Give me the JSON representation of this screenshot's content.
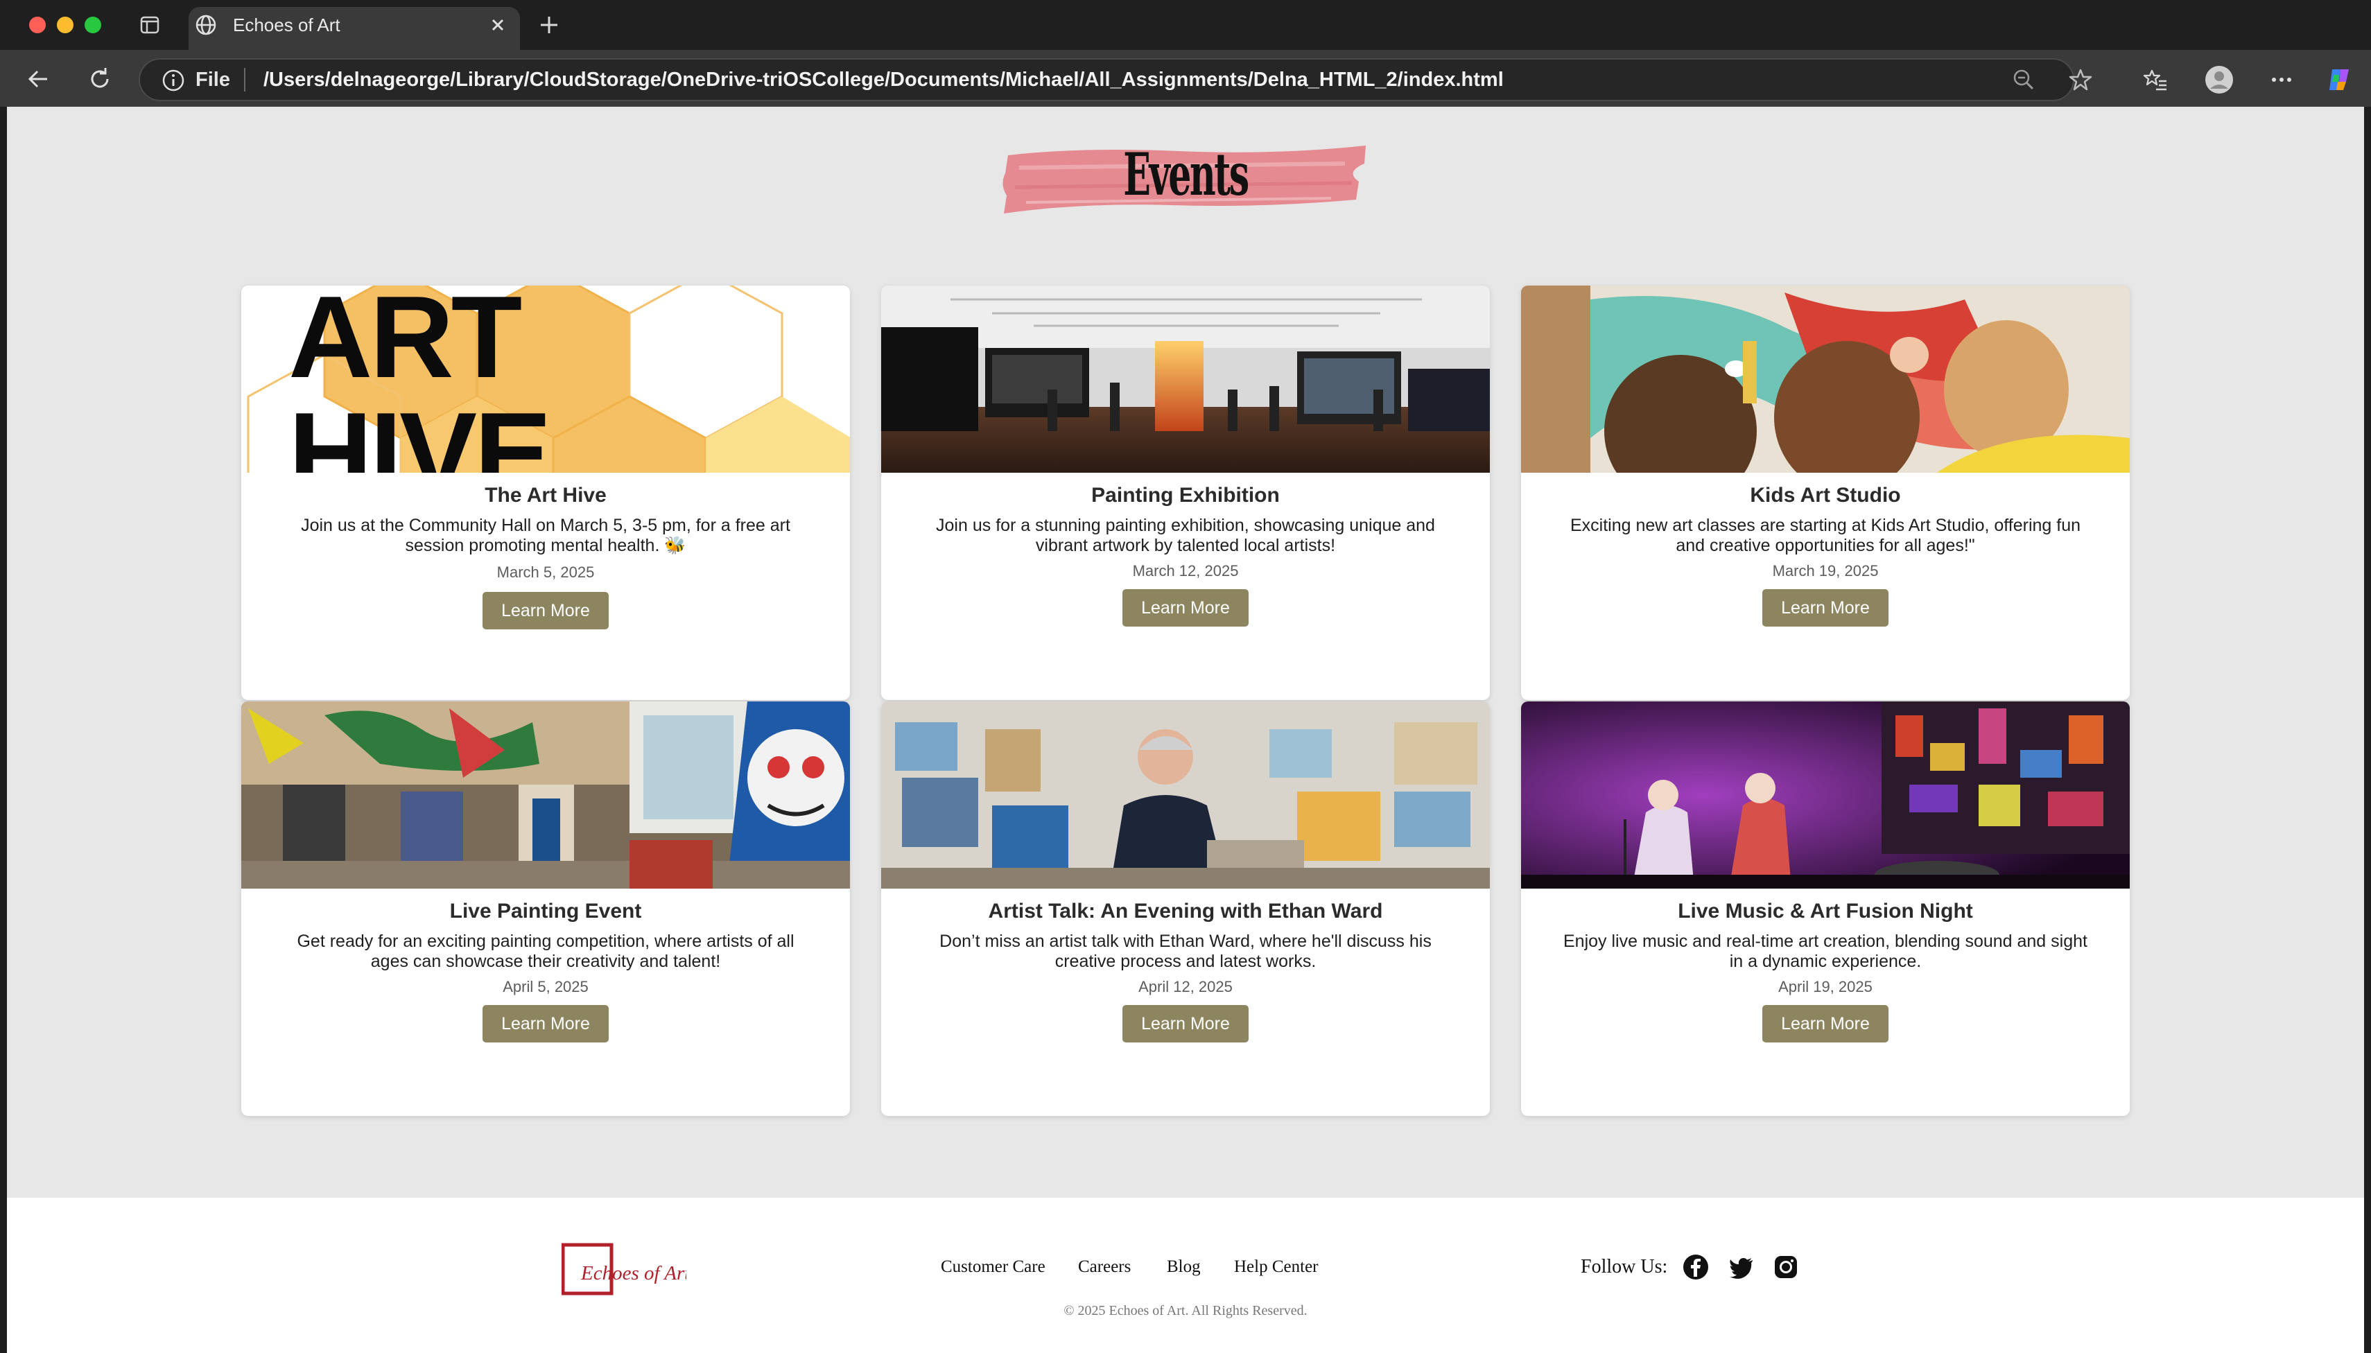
{
  "browser": {
    "tab_title": "Echoes of Art",
    "file_label": "File",
    "url": "/Users/delnageorge/Library/CloudStorage/OneDrive-triOSCollege/Documents/Michael/All_Assignments/Delna_HTML_2/index.html"
  },
  "page": {
    "title": "Events",
    "accent_color": "#8c855f",
    "brush_color": "#e58a90"
  },
  "events": [
    {
      "title": "The Art Hive",
      "description": "Join us at the Community Hall on March 5, 3-5 pm, for a free art session promoting mental health. 🐝",
      "date": "March 5, 2025",
      "button": "Learn More",
      "image_text": [
        "ART",
        "HIVE"
      ]
    },
    {
      "title": "Painting Exhibition",
      "description": "Join us for a stunning painting exhibition, showcasing unique and vibrant artwork by talented local artists!",
      "date": "March 12, 2025",
      "button": "Learn More"
    },
    {
      "title": "Kids Art Studio",
      "description": "Exciting new art classes are starting at Kids Art Studio, offering fun and creative opportunities for all ages!\"",
      "date": "March 19, 2025",
      "button": "Learn More"
    },
    {
      "title": "Live Painting Event",
      "description": "Get ready for an exciting painting competition, where artists of all ages can showcase their creativity and talent!",
      "date": "April 5, 2025",
      "button": "Learn More"
    },
    {
      "title": "Artist Talk: An Evening with Ethan Ward",
      "description": "Don’t miss an artist talk with Ethan Ward, where he'll discuss his creative process and latest works.",
      "date": "April 12, 2025",
      "button": "Learn More"
    },
    {
      "title": "Live Music & Art Fusion Night",
      "description": "Enjoy live music and real-time art creation, blending sound and sight in a dynamic experience.",
      "date": "April 19, 2025",
      "button": "Learn More"
    }
  ],
  "footer": {
    "logo_text": "Echoes of Art",
    "links": [
      "Customer Care",
      "Careers",
      "Blog",
      "Help Center"
    ],
    "follow_label": "Follow Us:",
    "social_icons": [
      "facebook-icon",
      "twitter-icon",
      "instagram-icon"
    ],
    "copyright": "© 2025 Echoes of Art. All Rights Reserved."
  }
}
